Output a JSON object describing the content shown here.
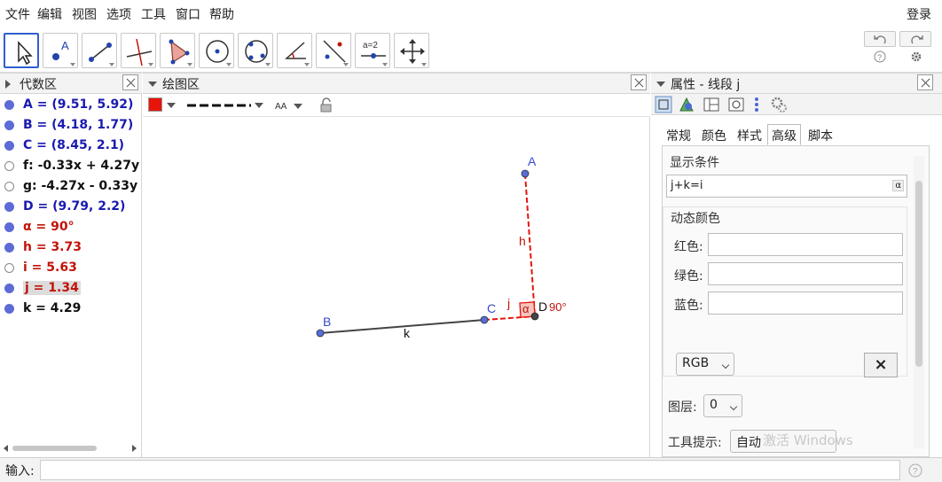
{
  "menu": {
    "items": [
      "文件",
      "编辑",
      "视图",
      "选项",
      "工具",
      "窗口",
      "帮助"
    ],
    "login": "登录"
  },
  "toolbar": {
    "tools": [
      "move",
      "point",
      "segment",
      "perpendicular",
      "polygon",
      "circle",
      "circle-three-points",
      "angle",
      "reflect",
      "slider",
      "move-view"
    ],
    "slider_label": "a=2",
    "selected": "move"
  },
  "algebra": {
    "title": "代数区",
    "items": [
      {
        "text": "A = (9.51, 5.92)",
        "color": "blue",
        "shown": true
      },
      {
        "text": "B = (4.18, 1.77)",
        "color": "blue",
        "shown": true
      },
      {
        "text": "C = (8.45, 2.1)",
        "color": "blue",
        "shown": true
      },
      {
        "text": "f: -0.33x + 4.27y =",
        "color": "black",
        "shown": false
      },
      {
        "text": "g: -4.27x - 0.33y =",
        "color": "black",
        "shown": false
      },
      {
        "text": "D = (9.79, 2.2)",
        "color": "blue",
        "shown": true
      },
      {
        "text": "α = 90°",
        "color": "red",
        "shown": true
      },
      {
        "text": "h = 3.73",
        "color": "red",
        "shown": true
      },
      {
        "text": "i = 5.63",
        "color": "red",
        "shown": false
      },
      {
        "text": "j = 1.34",
        "color": "red",
        "shown": true,
        "selected": true
      },
      {
        "text": "k = 4.29",
        "color": "black",
        "shown": true
      }
    ]
  },
  "graphics": {
    "title": "绘图区",
    "labels": {
      "A": "A",
      "B": "B",
      "C": "C",
      "D": "D",
      "h": "h",
      "j": "j",
      "k": "k",
      "alpha": "α",
      "angle": "90°"
    }
  },
  "properties": {
    "title": "属性 - 线段 j",
    "tabs": [
      "常规",
      "颜色",
      "样式",
      "高级",
      "脚本"
    ],
    "active_tab": "高级",
    "show_condition_label": "显示条件",
    "show_condition_value": "j+k=i",
    "alpha_button": "α",
    "dynamic_colors_label": "动态颜色",
    "red_label": "红色:",
    "green_label": "绿色:",
    "blue_label": "蓝色:",
    "color_space": "RGB",
    "clear_button": "×",
    "layer_label": "图层:",
    "layer_value": "0",
    "tooltip_label": "工具提示:",
    "tooltip_value": "自动"
  },
  "input": {
    "label": "输入:"
  },
  "watermark": "激活 Windows",
  "colors": {
    "accent": "#2f5fd0",
    "point": "#5c6bd6",
    "red": "#c0140a"
  }
}
